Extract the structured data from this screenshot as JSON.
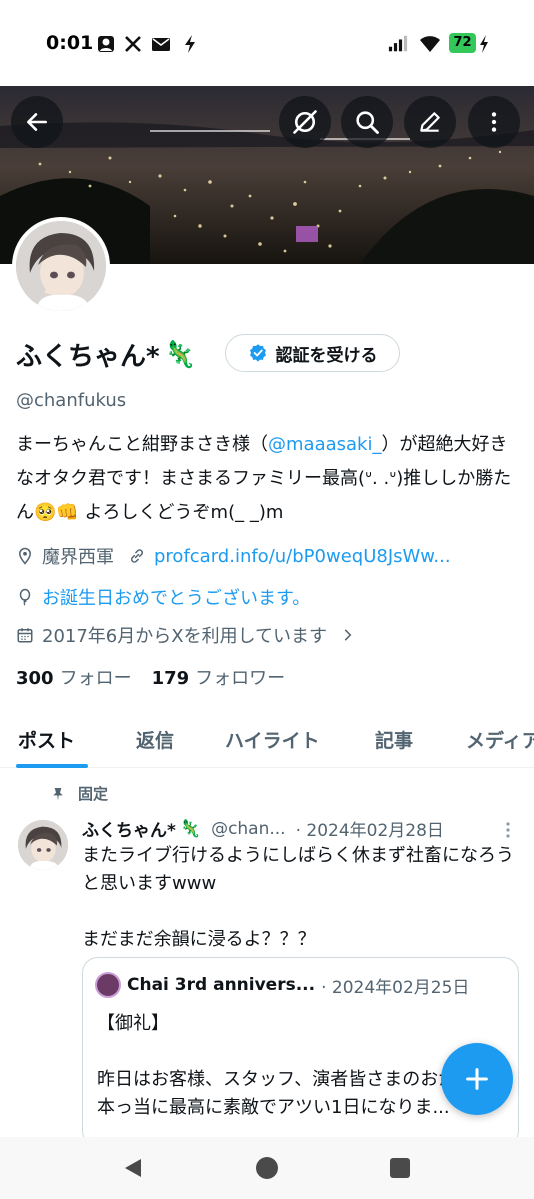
{
  "status_bar": {
    "time": "0:01",
    "battery": "72",
    "icons": [
      "notification-avatar-icon",
      "x-icon",
      "mail-icon",
      "bolt-icon",
      "signal-icon",
      "wifi-icon",
      "battery-icon",
      "charging-icon"
    ]
  },
  "header": {
    "back_icon": "arrow-left-icon",
    "actions": [
      "grok-icon",
      "search-icon",
      "edit-icon",
      "more-vertical-icon"
    ]
  },
  "profile": {
    "name": "ふくちゃん*",
    "name_emoji": "🦎",
    "verify_button": "認証を受ける",
    "handle": "@chanfukus",
    "bio": {
      "part1": "まーちゃんこと紺野まさき様（",
      "mention": "@maaasaki_",
      "part2": "）が超絶大好きなオタク君です！まさまるファミリー最高(ᐡ. .ᐡ)推ししか勝たん🥺👊 よろしくどうぞm(_ _)m"
    },
    "location": "魔界西軍",
    "website": "profcard.info/u/bP0weqU8JsWw...",
    "birthday": "お誕生日おめでとうございます。",
    "joined": "2017年6月からXを利用しています",
    "following_count": "300",
    "following_label": "フォロー",
    "followers_count": "179",
    "followers_label": "フォロワー"
  },
  "tabs": [
    "ポスト",
    "返信",
    "ハイライト",
    "記事",
    "メディア"
  ],
  "pinned_post": {
    "pinned_label": "固定",
    "author_name": "ふくちゃん*",
    "author_emoji": "🦎",
    "handle": "@chan...",
    "date": "· 2024年02月28日",
    "text": "またライブ行けるようにしばらく休まず社畜になろうと思いますwww\n\nまだまだ余韻に浸るよ？？？",
    "quote": {
      "author": "Chai 3rd annivers...",
      "date": "· 2024年02月25日",
      "text": "【御礼】\n\n昨日はお客様、スタッフ、演者皆さまのおかげで\n本っ当に最高に素敵でアツい1日になりま..."
    }
  },
  "fab_icon": "plus-icon",
  "nav": [
    "back-triangle-icon",
    "home-circle-icon",
    "recents-square-icon"
  ],
  "colors": {
    "accent": "#1d9bf0",
    "text_primary": "#0f1419",
    "text_secondary": "#536471",
    "border": "#cfd9de",
    "battery": "#34c759"
  }
}
